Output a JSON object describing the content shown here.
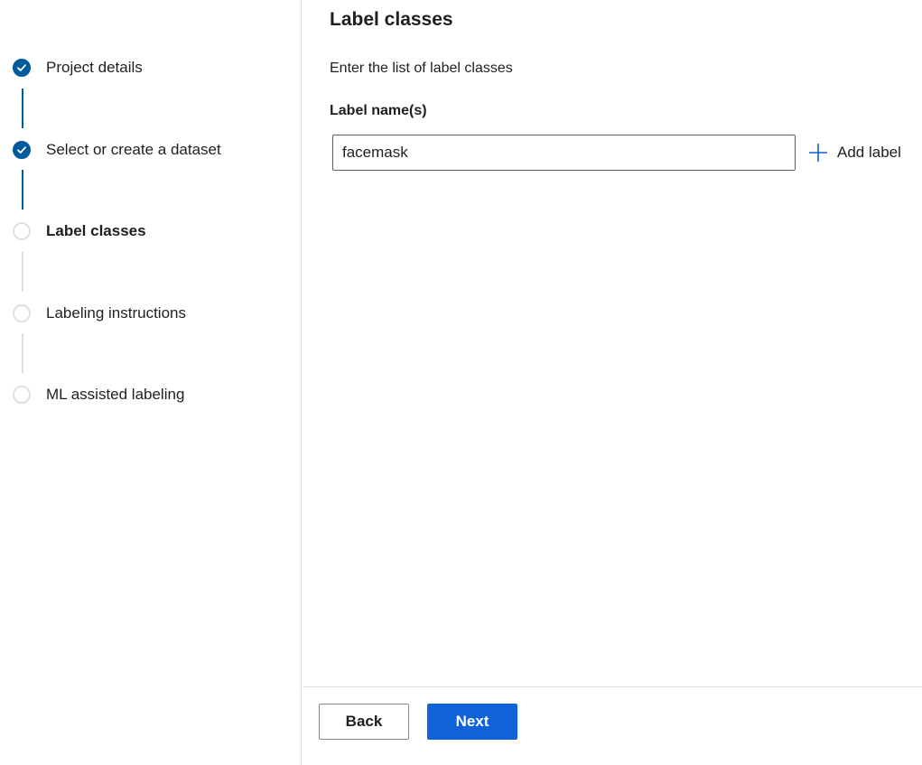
{
  "wizard": {
    "steps": [
      {
        "label": "Project details",
        "status": "completed"
      },
      {
        "label": "Select or create a dataset",
        "status": "completed"
      },
      {
        "label": "Label classes",
        "status": "current"
      },
      {
        "label": "Labeling instructions",
        "status": "pending"
      },
      {
        "label": "ML assisted labeling",
        "status": "pending"
      }
    ]
  },
  "main": {
    "title": "Label classes",
    "description": "Enter the list of label classes",
    "field_label": "Label name(s)",
    "label_input_value": "facemask",
    "add_label": "Add label"
  },
  "footer": {
    "back_label": "Back",
    "next_label": "Next"
  },
  "colors": {
    "accent": "#005a9e",
    "primary_button": "#0f62d8",
    "pending": "#e1dfdd",
    "border": "#e1dfdd"
  },
  "icons": {
    "completed_step": "checkmark-icon",
    "add": "plus-icon"
  }
}
